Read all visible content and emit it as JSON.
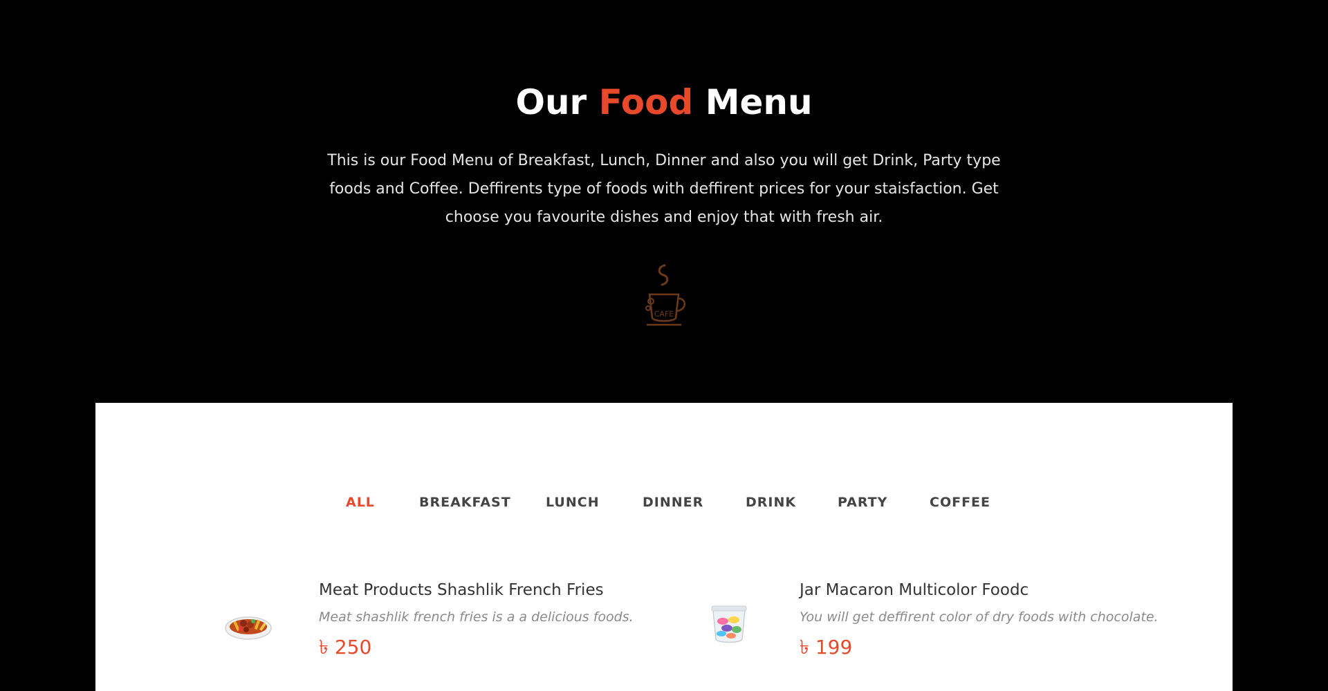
{
  "header": {
    "title_part1": "Our",
    "title_accent": "Food",
    "title_part2": "Menu",
    "intro": "This is our Food Menu of Breakfast, Lunch, Dinner and also you will get Drink, Party type foods and Coffee. Deffirents type of foods with deffirent prices for your staisfaction. Get choose you favourite dishes and enjoy that with fresh air.",
    "logo_icon": "cafe-cup-icon",
    "logo_text": "CAFE"
  },
  "tabs": [
    {
      "label": "ALL",
      "active": true
    },
    {
      "label": "BREAKFAST",
      "active": false
    },
    {
      "label": "LUNCH",
      "active": false
    },
    {
      "label": "DINNER",
      "active": false
    },
    {
      "label": "DRINK",
      "active": false
    },
    {
      "label": "PARTY",
      "active": false
    },
    {
      "label": "COFFEE",
      "active": false
    }
  ],
  "menu_items": [
    {
      "title": "Meat Products Shashlik French Fries",
      "description": "Meat shashlik french fries is a a delicious foods.",
      "price": "৳ 250",
      "icon": "shashlik-fries-plate-icon"
    },
    {
      "title": "Jar Macaron Multicolor Foodc",
      "description": "You will get deffirent color of dry foods with chocolate.",
      "price": "৳ 199",
      "icon": "macaron-jar-icon"
    }
  ],
  "colors": {
    "accent": "#e8492b",
    "hero_bg": "#000000",
    "panel_bg": "#ffffff",
    "tab_text": "#444444"
  }
}
